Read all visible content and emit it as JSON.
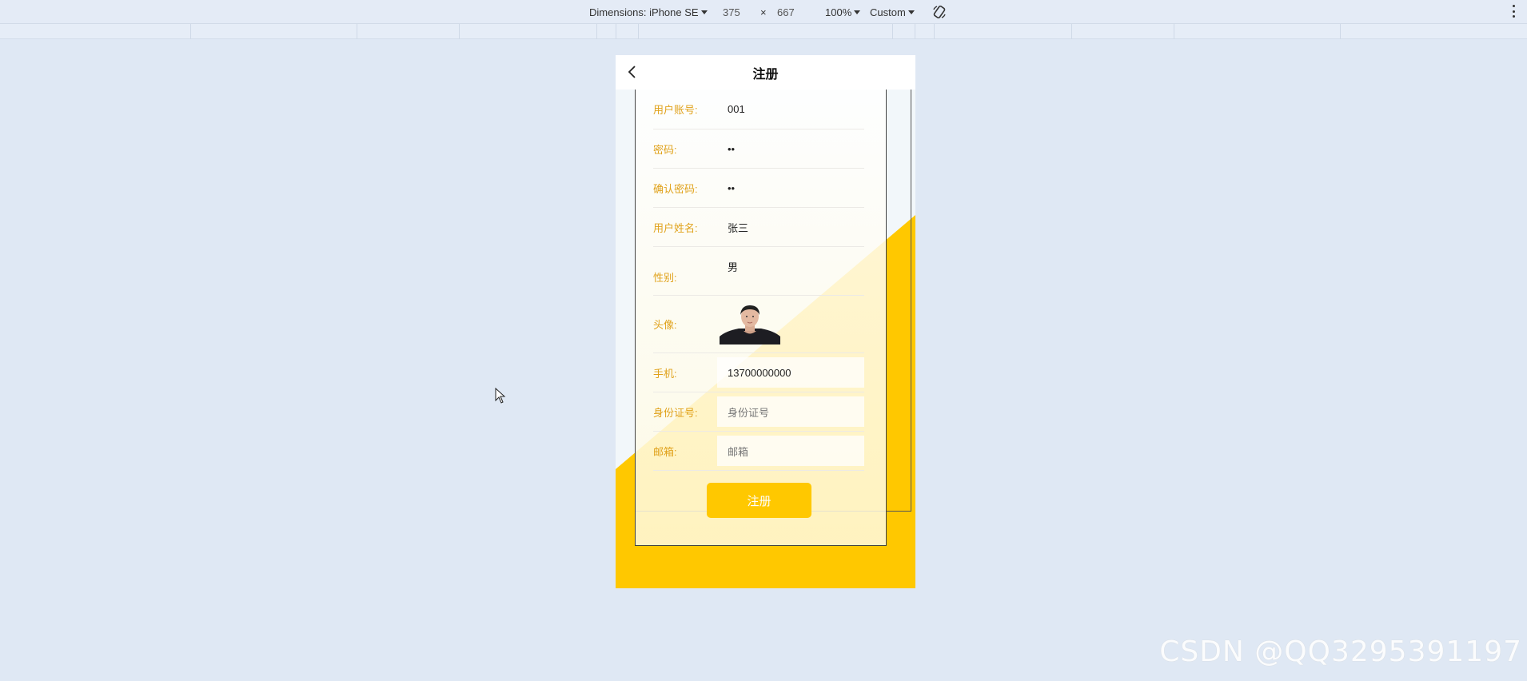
{
  "devtools": {
    "dimensions_label": "Dimensions: iPhone SE",
    "width": "375",
    "times": "×",
    "height": "667",
    "zoom": "100%",
    "throttle": "Custom"
  },
  "page": {
    "title": "注册",
    "fields": [
      {
        "label": "用户账号:",
        "value": "001"
      },
      {
        "label": "密码:",
        "value": "••"
      },
      {
        "label": "确认密码:",
        "value": "••"
      },
      {
        "label": "用户姓名:",
        "value": "张三"
      },
      {
        "label": "性别:",
        "value": "男"
      },
      {
        "label": "头像:",
        "value": ""
      },
      {
        "label": "手机:",
        "value": "13700000000"
      },
      {
        "label": "身份证号:",
        "placeholder": "身份证号"
      },
      {
        "label": "邮箱:",
        "placeholder": "邮箱"
      }
    ],
    "submit_label": "注册"
  },
  "colors": {
    "accent": "#ffc800",
    "label": "#e0a21b",
    "background": "#dfe8f4"
  },
  "icons": [
    "back-arrow-icon",
    "caret-down-icon",
    "rotate-icon",
    "more-vertical-icon",
    "cursor-icon"
  ],
  "watermark": "CSDN @QQ3295391197"
}
